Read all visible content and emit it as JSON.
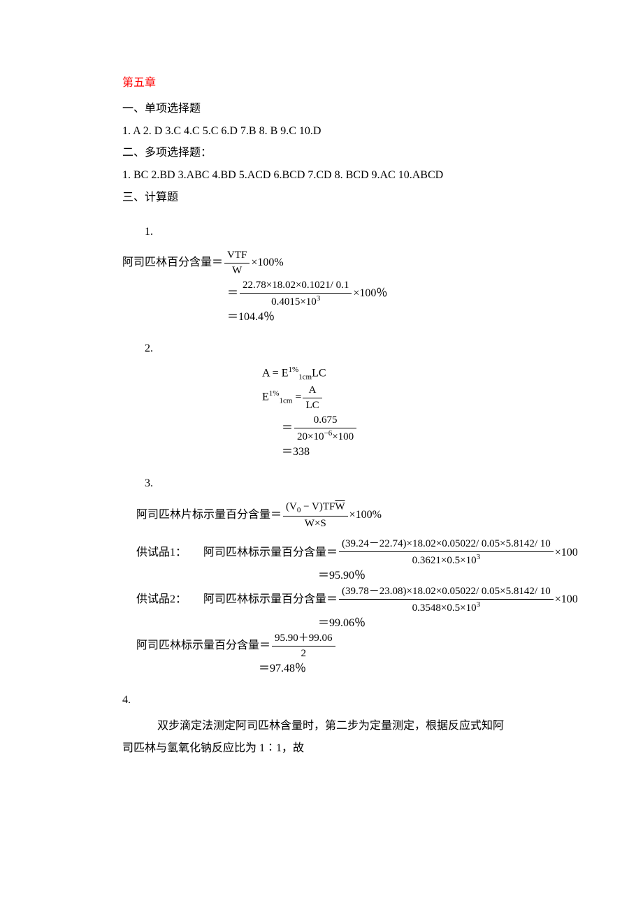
{
  "chapter_title": "第五章",
  "sections": {
    "s1_title": "一、单项选择题",
    "s1_answers": "1. A   2. D   3.C  4.C  5.C  6.D  7.B  8.  B  9.C  10.D",
    "s2_title": "二、多项选择题：",
    "s2_answers": " 1.  BC  2.BD  3.ABC  4.BD  5.ACD  6.BCD  7.CD  8.  BCD  9.AC  10.ABCD",
    "s3_title": "三、计算题"
  },
  "problems": {
    "p1": {
      "num": "1.",
      "label": "阿司匹林百分含量＝",
      "line1_num": "VTF",
      "line1_den": "W",
      "times100_cn": "×100%",
      "eq": "＝",
      "line2_num": "22.78×18.02×0.1021/ 0.1",
      "line2_den": "0.4015×10",
      "line2_den_sup": "3",
      "times100": "×100％",
      "line3": "＝104.4％"
    },
    "p2": {
      "num": "2.",
      "l1_lhs": "A = E",
      "l1_sup": "1%",
      "l1_sub": "1cm",
      "l1_rhs": "LC",
      "l2_lhs": "E",
      "l2_eq": " = ",
      "l2_num": "A",
      "l2_den": "LC",
      "l3_eq": "＝",
      "l3_num": "0.675",
      "l3_den_a": "20×10",
      "l3_den_sup": "−6",
      "l3_den_b": "×100",
      "l4": "＝338"
    },
    "p3": {
      "num": "3.",
      "header_label": "阿司匹林片标示量百分含量＝",
      "h_num_a": "(V",
      "h_num_sub": "0",
      "h_num_b": " − V)TF",
      "h_num_wbar": "W",
      "h_den": "W×S",
      "times100": "×100%",
      "s1_label": "供试品1：",
      "s1_expr_label": "阿司匹林标示量百分含量＝",
      "s1_num": "(39.24－22.74)×18.02×0.05022/ 0.05×5.8142/ 10",
      "s1_den_a": "0.3621×0.5×10",
      "s1_den_sup": "3",
      "s1_tail": "×100",
      "s1_res": "＝95.90％",
      "s2_label": "供试品2：",
      "s2_expr_label": "阿司匹林标示量百分含量＝",
      "s2_num": "(39.78－23.08)×18.02×0.05022/ 0.05×5.8142/ 10",
      "s2_den_a": "0.3548×0.5×10",
      "s2_den_sup": "3",
      "s2_tail": "×100",
      "s2_res": "＝99.06％",
      "avg_label": "阿司匹林标示量百分含量＝",
      "avg_num": "95.90＋99.06",
      "avg_den": "2",
      "avg_res": "＝97.48％"
    },
    "p4": {
      "num": "4.",
      "l1": "双步滴定法测定阿司匹林含量时，第二步为定量测定，根据反应式知阿",
      "l2": "司匹林与氢氧化钠反应比为 1∶1，故"
    }
  }
}
